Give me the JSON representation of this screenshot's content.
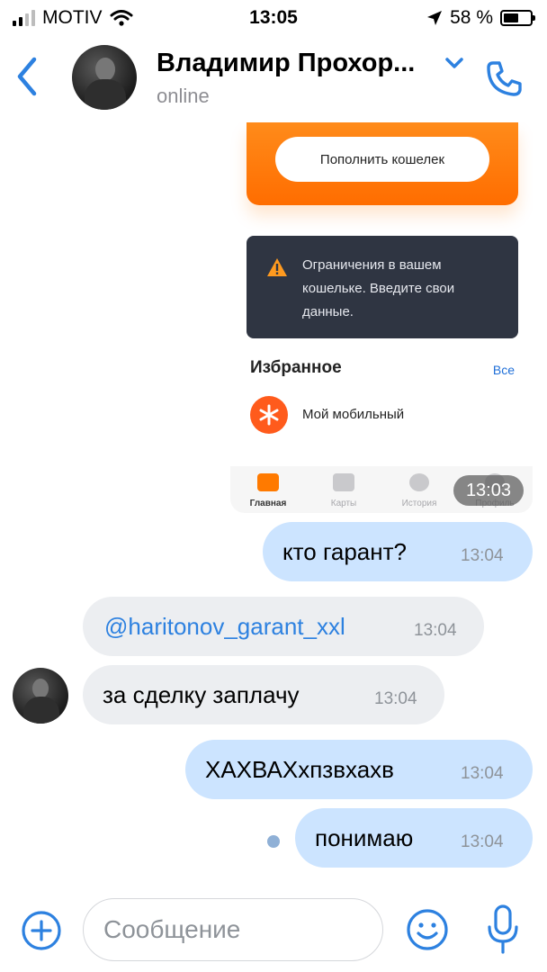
{
  "status_bar": {
    "carrier": "MOTIV",
    "time": "13:05",
    "battery": "58 %",
    "battery_level": 0.58
  },
  "header": {
    "contact_name": "Владимир Прохор...",
    "status": "online"
  },
  "screenshot": {
    "topup_label": "Пополнить кошелек",
    "warning_text": "Ограничения в вашем кошельке. Введите свои данные.",
    "favorites_title": "Избранное",
    "favorites_all": "Все",
    "favorite_item": "Мой мобильный",
    "tabs": [
      "Главная",
      "Карты",
      "История",
      "Профиль"
    ],
    "time": "13:03"
  },
  "messages": [
    {
      "direction": "out",
      "text": "кто гарант?",
      "time": "13:04"
    },
    {
      "direction": "in",
      "text": "@haritonov_garant_xxl",
      "time": "13:04"
    },
    {
      "direction": "in",
      "text": "за сделку заплачу",
      "time": "13:04"
    },
    {
      "direction": "out",
      "text": "ХАХВАХхпзвхахв",
      "time": "13:04"
    },
    {
      "direction": "out",
      "text": "понимаю",
      "time": "13:04"
    }
  ],
  "composer": {
    "placeholder": "Сообщение"
  },
  "colors": {
    "accent": "#2d81e0",
    "outgoing_bubble": "#cce4ff",
    "incoming_bubble": "#eceef1",
    "orange": "#ff7a00"
  },
  "icons": [
    "signal-icon",
    "wifi-icon",
    "location-arrow-icon",
    "battery-icon",
    "back-chevron-icon",
    "chevron-down-icon",
    "phone-icon",
    "warning-icon",
    "plus-circle-icon",
    "emoji-icon",
    "microphone-icon"
  ]
}
